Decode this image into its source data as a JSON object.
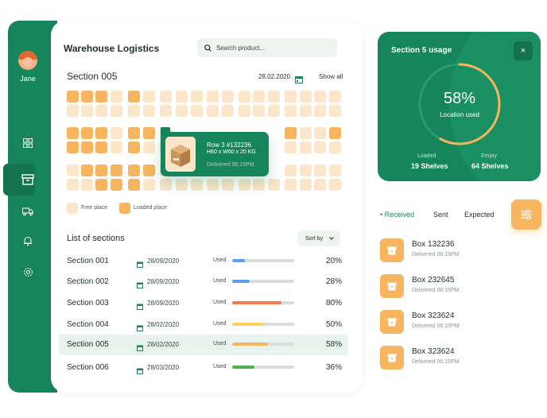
{
  "user": {
    "name": "Jane"
  },
  "header": {
    "title": "Warehouse Logistics",
    "search_placeholder": "Search product..."
  },
  "section": {
    "title": "Section 005",
    "date": "28.02.2020",
    "show_all": "Show all"
  },
  "legend": {
    "free": "Free place",
    "loaded": "Loaded place"
  },
  "popup": {
    "row": "Row 3 #132236",
    "dimensions": "H60 x W60 x 20 KG",
    "delivered": "Delivered 06:15PM"
  },
  "list": {
    "title": "List of sections",
    "sort_label": "Sort by",
    "used_label": "Used",
    "rows": [
      {
        "name": "Section 001",
        "date": "28/09/2020",
        "pct": "20%",
        "value": 0.2,
        "color": "#5b9cf5"
      },
      {
        "name": "Section 002",
        "date": "28/09/2020",
        "pct": "28%",
        "value": 0.28,
        "color": "#5b9cf5"
      },
      {
        "name": "Section 003",
        "date": "28/09/2020",
        "pct": "80%",
        "value": 0.8,
        "color": "#f47c48"
      },
      {
        "name": "Section 004",
        "date": "28/02/2020",
        "pct": "50%",
        "value": 0.5,
        "color": "#f9d35c"
      },
      {
        "name": "Section 005",
        "date": "28/02/2020",
        "pct": "58%",
        "value": 0.58,
        "color": "#f6b55e"
      },
      {
        "name": "Section 006",
        "date": "28/03/2020",
        "pct": "36%",
        "value": 0.36,
        "color": "#4caf50"
      }
    ]
  },
  "usage": {
    "title": "Section 5 usage",
    "close": "×",
    "percent": "58%",
    "value": 0.58,
    "caption": "Location used",
    "loaded_label": "Loaded",
    "loaded_value": "19 Shelves",
    "empty_label": "Empty",
    "empty_value": "64 Shelves"
  },
  "tabs": {
    "received": "Received",
    "sent": "Sent",
    "expected": "Expected"
  },
  "boxes": [
    {
      "name": "Box 132236",
      "delivered": "Delivered 06:15PM"
    },
    {
      "name": "Box 232645",
      "delivered": "Delivered 06:15PM"
    },
    {
      "name": "Box 323624",
      "delivered": "Delivered 06:15PM"
    },
    {
      "name": "Box 323624",
      "delivered": "Delivered 06:15PM"
    }
  ],
  "grid": {
    "rows": [
      "LLLFLFFFFFFFFFFFFF",
      "FFFFFFFFFFFFFFFFFF",
      "LLLFLLFFFFFFLLLFFL",
      "LLLFLFFFFFFFFFFFFF",
      "FLLLLLFFFFFFFFFFFF",
      "FFLLLFFFFFFFFFFFFF"
    ]
  },
  "colors": {
    "brand": "#17855b",
    "accent": "#f6b55e",
    "free": "#fbe6c9"
  }
}
